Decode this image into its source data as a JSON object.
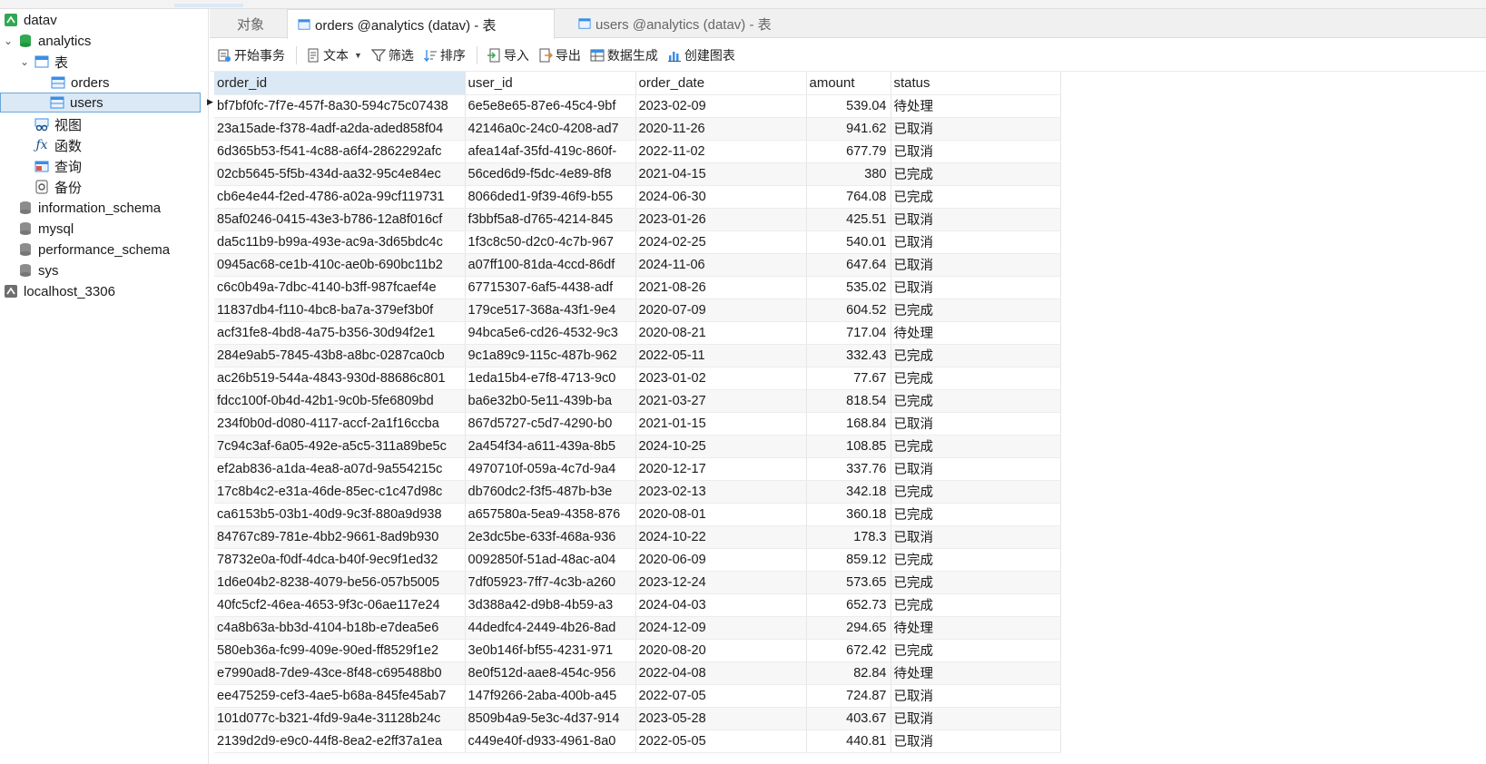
{
  "sidebar": {
    "items": [
      {
        "label": "datav",
        "icon": "connection-icon"
      },
      {
        "label": "analytics",
        "icon": "database-icon"
      },
      {
        "label": "表",
        "icon": "tables-folder-icon"
      },
      {
        "label": "orders",
        "icon": "table-icon"
      },
      {
        "label": "users",
        "icon": "table-icon"
      },
      {
        "label": "视图",
        "icon": "views-icon"
      },
      {
        "label": "函数",
        "icon": "function-icon"
      },
      {
        "label": "查询",
        "icon": "query-icon"
      },
      {
        "label": "备份",
        "icon": "backup-icon"
      },
      {
        "label": "information_schema",
        "icon": "database-grey-icon"
      },
      {
        "label": "mysql",
        "icon": "database-grey-icon"
      },
      {
        "label": "performance_schema",
        "icon": "database-grey-icon"
      },
      {
        "label": "sys",
        "icon": "database-grey-icon"
      },
      {
        "label": "localhost_3306",
        "icon": "connection-grey-icon"
      }
    ]
  },
  "tabs": [
    {
      "label": "对象"
    },
    {
      "label": "orders @analytics (datav) - 表"
    },
    {
      "label": "users @analytics (datav) - 表"
    }
  ],
  "toolbar": {
    "begin_transaction": "开始事务",
    "text": "文本",
    "filter": "筛选",
    "sort": "排序",
    "import": "导入",
    "export": "导出",
    "data_generation": "数据生成",
    "create_chart": "创建图表"
  },
  "table": {
    "columns": [
      "order_id",
      "user_id",
      "order_date",
      "amount",
      "status"
    ],
    "rows": [
      [
        "bf7bf0fc-7f7e-457f-8a30-594c75c07438",
        "6e5e8e65-87e6-45c4-9bf",
        "2023-02-09",
        "539.04",
        "待处理"
      ],
      [
        "23a15ade-f378-4adf-a2da-aded858f04",
        "42146a0c-24c0-4208-ad7",
        "2020-11-26",
        "941.62",
        "已取消"
      ],
      [
        "6d365b53-f541-4c88-a6f4-2862292afc",
        "afea14af-35fd-419c-860f-",
        "2022-11-02",
        "677.79",
        "已取消"
      ],
      [
        "02cb5645-5f5b-434d-aa32-95c4e84ec",
        "56ced6d9-f5dc-4e89-8f8",
        "2021-04-15",
        "380",
        "已完成"
      ],
      [
        "cb6e4e44-f2ed-4786-a02a-99cf119731",
        "8066ded1-9f39-46f9-b55",
        "2024-06-30",
        "764.08",
        "已完成"
      ],
      [
        "85af0246-0415-43e3-b786-12a8f016cf",
        "f3bbf5a8-d765-4214-845",
        "2023-01-26",
        "425.51",
        "已取消"
      ],
      [
        "da5c11b9-b99a-493e-ac9a-3d65bdc4c",
        "1f3c8c50-d2c0-4c7b-967",
        "2024-02-25",
        "540.01",
        "已取消"
      ],
      [
        "0945ac68-ce1b-410c-ae0b-690bc11b2",
        "a07ff100-81da-4ccd-86df",
        "2024-11-06",
        "647.64",
        "已取消"
      ],
      [
        "c6c0b49a-7dbc-4140-b3ff-987fcaef4e",
        "67715307-6af5-4438-adf",
        "2021-08-26",
        "535.02",
        "已取消"
      ],
      [
        "11837db4-f110-4bc8-ba7a-379ef3b0f",
        "179ce517-368a-43f1-9e4",
        "2020-07-09",
        "604.52",
        "已完成"
      ],
      [
        "acf31fe8-4bd8-4a75-b356-30d94f2e1",
        "94bca5e6-cd26-4532-9c3",
        "2020-08-21",
        "717.04",
        "待处理"
      ],
      [
        "284e9ab5-7845-43b8-a8bc-0287ca0cb",
        "9c1a89c9-115c-487b-962",
        "2022-05-11",
        "332.43",
        "已完成"
      ],
      [
        "ac26b519-544a-4843-930d-88686c801",
        "1eda15b4-e7f8-4713-9c0",
        "2023-01-02",
        "77.67",
        "已完成"
      ],
      [
        "fdcc100f-0b4d-42b1-9c0b-5fe6809bd",
        "ba6e32b0-5e11-439b-ba",
        "2021-03-27",
        "818.54",
        "已完成"
      ],
      [
        "234f0b0d-d080-4117-accf-2a1f16ccba",
        "867d5727-c5d7-4290-b0",
        "2021-01-15",
        "168.84",
        "已取消"
      ],
      [
        "7c94c3af-6a05-492e-a5c5-311a89be5c",
        "2a454f34-a611-439a-8b5",
        "2024-10-25",
        "108.85",
        "已完成"
      ],
      [
        "ef2ab836-a1da-4ea8-a07d-9a554215c",
        "4970710f-059a-4c7d-9a4",
        "2020-12-17",
        "337.76",
        "已取消"
      ],
      [
        "17c8b4c2-e31a-46de-85ec-c1c47d98c",
        "db760dc2-f3f5-487b-b3e",
        "2023-02-13",
        "342.18",
        "已完成"
      ],
      [
        "ca6153b5-03b1-40d9-9c3f-880a9d938",
        "a657580a-5ea9-4358-876",
        "2020-08-01",
        "360.18",
        "已完成"
      ],
      [
        "84767c89-781e-4bb2-9661-8ad9b930",
        "2e3dc5be-633f-468a-936",
        "2024-10-22",
        "178.3",
        "已取消"
      ],
      [
        "78732e0a-f0df-4dca-b40f-9ec9f1ed32",
        "0092850f-51ad-48ac-a04",
        "2020-06-09",
        "859.12",
        "已完成"
      ],
      [
        "1d6e04b2-8238-4079-be56-057b5005",
        "7df05923-7ff7-4c3b-a260",
        "2023-12-24",
        "573.65",
        "已完成"
      ],
      [
        "40fc5cf2-46ea-4653-9f3c-06ae117e24",
        "3d388a42-d9b8-4b59-a3",
        "2024-04-03",
        "652.73",
        "已完成"
      ],
      [
        "c4a8b63a-bb3d-4104-b18b-e7dea5e6",
        "44dedfc4-2449-4b26-8ad",
        "2024-12-09",
        "294.65",
        "待处理"
      ],
      [
        "580eb36a-fc99-409e-90ed-ff8529f1e2",
        "3e0b146f-bf55-4231-971",
        "2020-08-20",
        "672.42",
        "已完成"
      ],
      [
        "e7990ad8-7de9-43ce-8f48-c695488b0",
        "8e0f512d-aae8-454c-956",
        "2022-04-08",
        "82.84",
        "待处理"
      ],
      [
        "ee475259-cef3-4ae5-b68a-845fe45ab7",
        "147f9266-2aba-400b-a45",
        "2022-07-05",
        "724.87",
        "已取消"
      ],
      [
        "101d077c-b321-4fd9-9a4e-31128b24c",
        "8509b4a9-5e3c-4d37-914",
        "2023-05-28",
        "403.67",
        "已取消"
      ],
      [
        "2139d2d9-e9c0-44f8-8ea2-e2ff37a1ea",
        "c449e40f-d933-4961-8a0",
        "2022-05-05",
        "440.81",
        "已取消"
      ]
    ]
  },
  "colors": {
    "selection": "#dbe9f6",
    "selection_border": "#6aa6d8",
    "table_icon": "#3a8ee6",
    "db_icon": "#2fa84f"
  }
}
